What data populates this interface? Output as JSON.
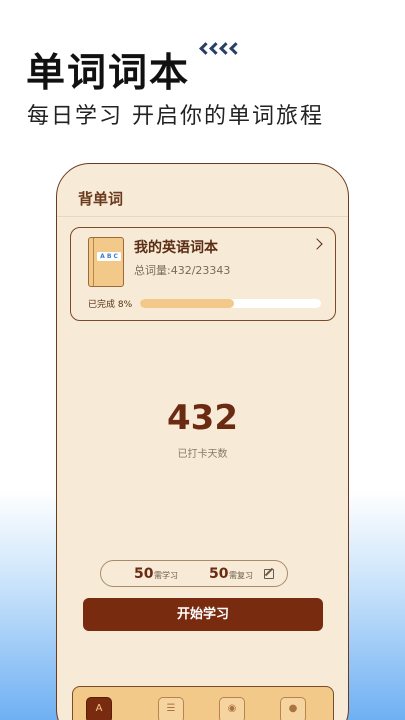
{
  "hero": {
    "title": "单词词本",
    "subtitle": "每日学习 开启你的单词旅程"
  },
  "screen": {
    "title": "背单词",
    "book": {
      "name": "我的英语词本",
      "cover_label": "A B C",
      "count": "总词量:432/23343",
      "progress_label": "已完成 8%",
      "progress_percent": 8
    },
    "days": {
      "number": "432",
      "label": "已打卡天数"
    },
    "stats": {
      "learn_num": "50",
      "learn_label": "需学习",
      "review_num": "50",
      "review_label": "需复习"
    },
    "start_button": "开始学习"
  },
  "nav": {
    "items": [
      {
        "icon": "book-a-icon",
        "glyph": "A",
        "active": true
      },
      {
        "icon": "list-icon",
        "glyph": "☰",
        "active": false
      },
      {
        "icon": "camera-icon",
        "glyph": "◉",
        "active": false
      },
      {
        "icon": "profile-icon",
        "glyph": "●",
        "active": false
      }
    ]
  },
  "colors": {
    "accent": "#792b10",
    "card_bg": "#f7ead6",
    "progress": "#f3c98a"
  }
}
